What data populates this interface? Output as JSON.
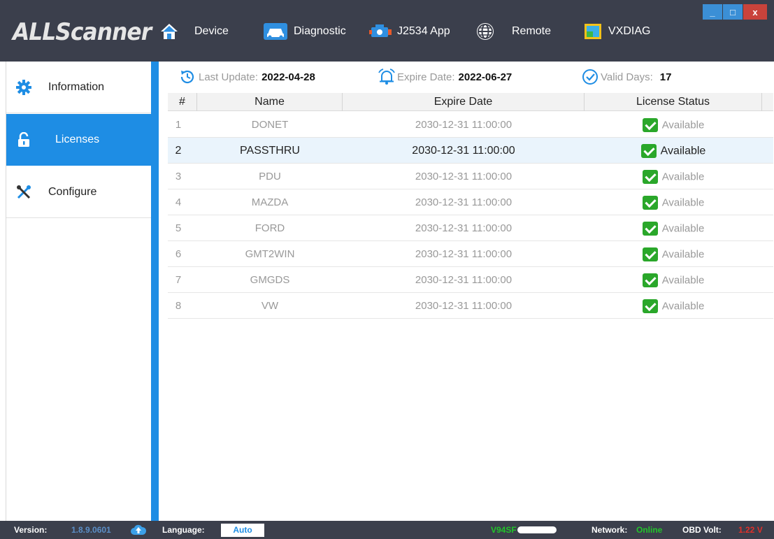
{
  "app": {
    "logo_text": "ALLScanner"
  },
  "nav": {
    "home_icon": "home-icon",
    "items": [
      {
        "label": "Device",
        "icon": "device-icon"
      },
      {
        "label": "Diagnostic",
        "icon": "car-icon"
      },
      {
        "label": "J2534 App",
        "icon": "engine-icon"
      },
      {
        "label": "Remote",
        "icon": "globe-icon"
      },
      {
        "label": "VXDIAG",
        "icon": "vxdiag-icon"
      }
    ]
  },
  "window": {
    "minimize": "_",
    "maximize": "□",
    "close": "x"
  },
  "sidebar": {
    "items": [
      {
        "label": "Information",
        "icon": "gear-icon"
      },
      {
        "label": "Licenses",
        "icon": "lock-icon",
        "active": true
      },
      {
        "label": "Configure",
        "icon": "tools-icon"
      }
    ]
  },
  "info": {
    "last_update_label": "Last Update:",
    "last_update_value": "2022-04-28",
    "expire_label": "Expire Date:",
    "expire_value": "2022-06-27",
    "valid_label": "Valid Days:",
    "valid_value": "17"
  },
  "table": {
    "columns": [
      "#",
      "Name",
      "Expire Date",
      "License Status"
    ],
    "rows": [
      {
        "num": "1",
        "name": "DONET",
        "expire": "2030-12-31 11:00:00",
        "status": "Available"
      },
      {
        "num": "2",
        "name": "PASSTHRU",
        "expire": "2030-12-31 11:00:00",
        "status": "Available"
      },
      {
        "num": "3",
        "name": "PDU",
        "expire": "2030-12-31 11:00:00",
        "status": "Available"
      },
      {
        "num": "4",
        "name": "MAZDA",
        "expire": "2030-12-31 11:00:00",
        "status": "Available"
      },
      {
        "num": "5",
        "name": "FORD",
        "expire": "2030-12-31 11:00:00",
        "status": "Available"
      },
      {
        "num": "6",
        "name": "GMT2WIN",
        "expire": "2030-12-31 11:00:00",
        "status": "Available"
      },
      {
        "num": "7",
        "name": "GMGDS",
        "expire": "2030-12-31 11:00:00",
        "status": "Available"
      },
      {
        "num": "8",
        "name": "VW",
        "expire": "2030-12-31 11:00:00",
        "status": "Available"
      }
    ]
  },
  "statusbar": {
    "version_label": "Version:",
    "version_value": "1.8.9.0601",
    "language_label": "Language:",
    "language_value": "Auto",
    "serial_value": "V94SF",
    "network_label": "Network:",
    "network_value": "Online",
    "obd_label": "OBD Volt:",
    "obd_value": "1.22 V"
  },
  "colors": {
    "titlebar": "#3b3f4c",
    "accent": "#1e8de4",
    "available": "#2aa72a",
    "online": "#22c42a",
    "volt": "#e0302a"
  }
}
